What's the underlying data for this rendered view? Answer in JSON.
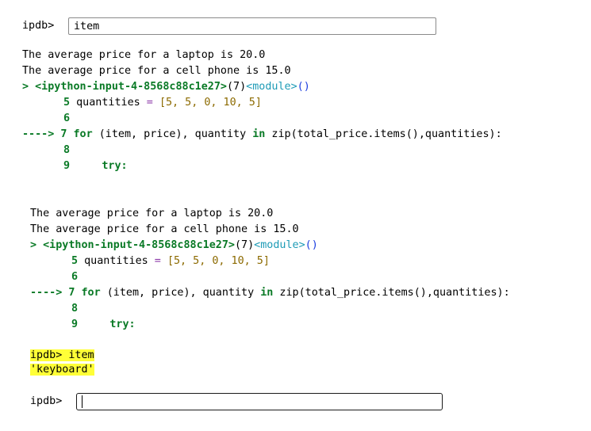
{
  "prompt1": {
    "label": "ipdb>",
    "value": "item"
  },
  "block1": {
    "out1": "The average price for a laptop is 20.0",
    "out2": "The average price for a cell phone is 15.0",
    "frame_marker": ">",
    "frame_file": "<ipython-input-4-8568c88c1e27>",
    "frame_line": "(7)",
    "frame_module": "<module>",
    "frame_parens": "()",
    "l5_num": "5",
    "l5_code_a": "quantities",
    "l5_code_b": " = ",
    "l5_code_c": "[5, 5, 0, 10, 5]",
    "l6_num": "6",
    "arrow": "---->",
    "l7_num": "7",
    "l7_for": "for",
    "l7_rest_a": " (item, price), quantity ",
    "l7_in": "in",
    "l7_rest_b": " zip(total_price.items(),quantities):",
    "l8_num": "8",
    "l9_num": "9",
    "l9_try": "try:"
  },
  "block2": {
    "out1": "The average price for a laptop is 20.0",
    "out2": "The average price for a cell phone is 15.0",
    "frame_marker": ">",
    "frame_file": "<ipython-input-4-8568c88c1e27>",
    "frame_line": "(7)",
    "frame_module": "<module>",
    "frame_parens": "()",
    "l5_num": "5",
    "l5_code_a": "quantities",
    "l5_code_b": " = ",
    "l5_code_c": "[5, 5, 0, 10, 5]",
    "l6_num": "6",
    "arrow": "---->",
    "l7_num": "7",
    "l7_for": "for",
    "l7_rest_a": " (item, price), quantity ",
    "l7_in": "in",
    "l7_rest_b": " zip(total_price.items(),quantities):",
    "l8_num": "8",
    "l9_num": "9",
    "l9_try": "try:"
  },
  "history": {
    "cmd": "ipdb> item",
    "result": "'keyboard'"
  },
  "prompt2": {
    "label": "ipdb>",
    "value": ""
  },
  "colors": {
    "highlight": "#ffff37",
    "green": "#0a7a26",
    "cyan": "#1d9bb6",
    "blue": "#1d3fe0"
  }
}
